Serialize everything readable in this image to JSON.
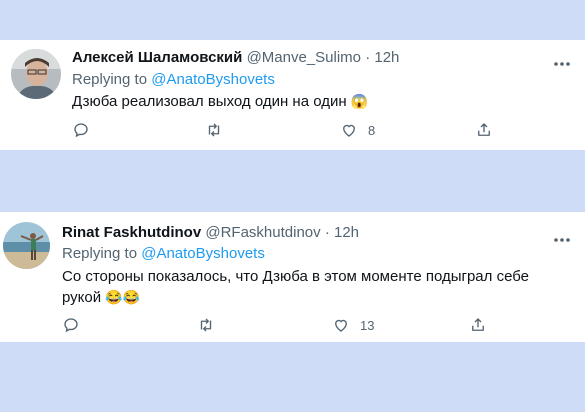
{
  "tweets": [
    {
      "name": "Алексей Шаламовский",
      "handle": "@Manve_Sulimo",
      "time": "12h",
      "replying_prefix": "Replying to",
      "replying_to": "@AnatoByshovets",
      "text": "Дзюба реализовал выход один на один",
      "emoji": "😱",
      "likes": "8",
      "avatar_icon": "user-photo"
    },
    {
      "name": "Rinat Faskhutdinov",
      "handle": "@RFaskhutdinov",
      "time": "12h",
      "replying_prefix": "Replying to",
      "replying_to": "@AnatoByshovets",
      "text": "Со стороны показалось, что Дзюба в этом моменте подыграл себе рукой",
      "emoji": "😂😂",
      "likes": "13",
      "avatar_icon": "beach-photo"
    }
  ],
  "separator": "·",
  "colors": {
    "background": "#cfdcf8",
    "card": "#ffffff",
    "link": "#1d9bf0",
    "muted": "#536471",
    "text": "#0f1419"
  }
}
